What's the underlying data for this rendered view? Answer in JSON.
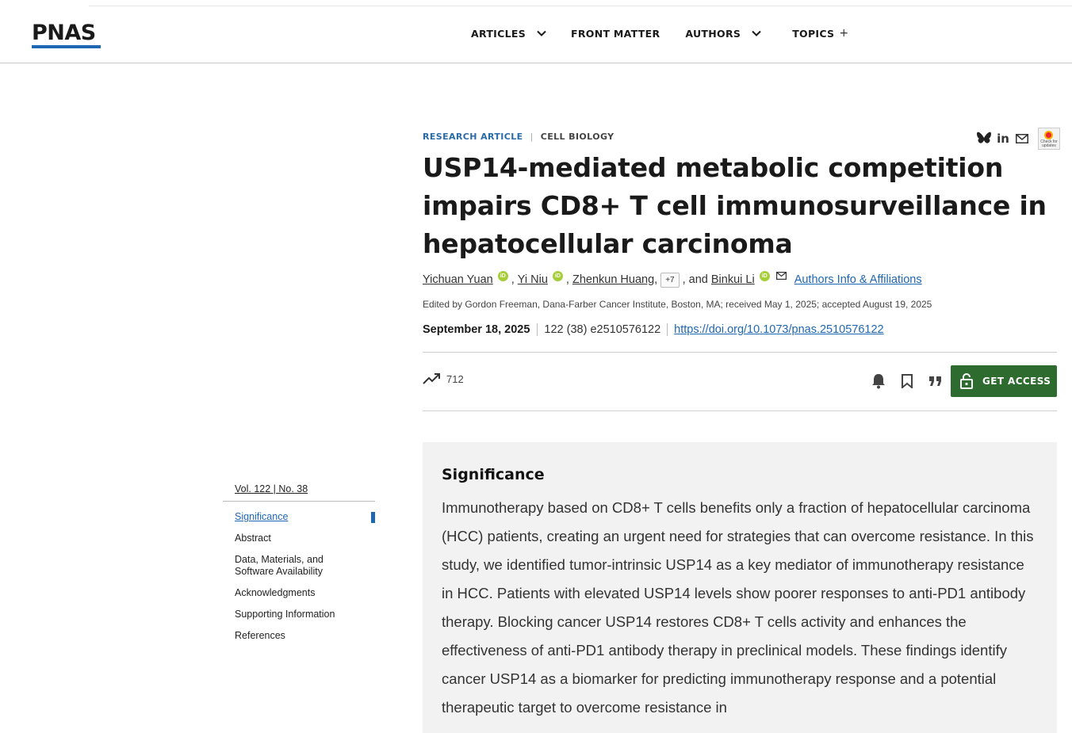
{
  "header": {
    "logo": "PNAS",
    "nav": [
      {
        "label": "ARTICLES",
        "dropdown": true
      },
      {
        "label": "FRONT MATTER",
        "dropdown": false
      },
      {
        "label": "AUTHORS",
        "dropdown": true
      },
      {
        "label": "TOPICS",
        "dropdown": false,
        "plus": "+"
      }
    ]
  },
  "article": {
    "type": "RESEARCH ARTICLE",
    "section": "CELL BIOLOGY",
    "title": "USP14-mediated metabolic competition impairs CD8+ T cell immunosurveillance in hepatocellular carcinoma",
    "authors": [
      {
        "name": "Yichuan Yuan",
        "sep": ","
      },
      {
        "name": "Yi Niu",
        "sep": ","
      },
      {
        "name": "Zhenkun Huang",
        "sep": ","
      }
    ],
    "more_authors": "+7",
    "and_text": ", and",
    "last_author": "Binkui Li",
    "orcid_label": "iD",
    "affiliations_link": "Authors Info & Affiliations",
    "edited_line": "Edited by Gordon Freeman, Dana-Farber Cancer Institute, Boston, MA; received May 1, 2025; accepted August 19, 2025",
    "pub_date": "September 18, 2025",
    "volume_info": "122 (38) e2510576122",
    "doi": "https://doi.org/10.1073/pnas.2510576122",
    "metric_count": "712",
    "get_access": "GET ACCESS"
  },
  "share": {
    "icons": [
      "bluesky-icon",
      "linkedin-icon",
      "email-icon",
      "crossmark-icon"
    ],
    "linkedin_text": "in",
    "crossmark_text": "Check for updates"
  },
  "toc": {
    "issue": "Vol. 122 | No. 38",
    "items": [
      "Significance",
      "Abstract",
      "Data, Materials, and Software Availability",
      "Acknowledgments",
      "Supporting Information",
      "References"
    ],
    "active": "Significance"
  },
  "significance": {
    "heading": "Significance",
    "text": "Immunotherapy based on CD8+ T cells benefits only a fraction of hepatocellular carcinoma (HCC) patients, creating an urgent need for strategies that can overcome resistance. In this study, we identified tumor-intrinsic USP14 as a key mediator of immunotherapy resistance in HCC. Patients with elevated USP14 levels show poorer responses to anti-PD1 antibody therapy. Blocking cancer USP14 restores CD8+ T cells activity and enhances the effectiveness of anti-PD1 antibody therapy in preclinical models. These findings identify cancer USP14 as a biomarker for predicting immunotherapy response and a potential therapeutic target to overcome resistance in"
  },
  "colors": {
    "brand_blue": "#1f66b3",
    "access_green": "#2e6b2e",
    "orcid_green": "#a6ce39",
    "panel_gray": "#f2f2f2"
  }
}
